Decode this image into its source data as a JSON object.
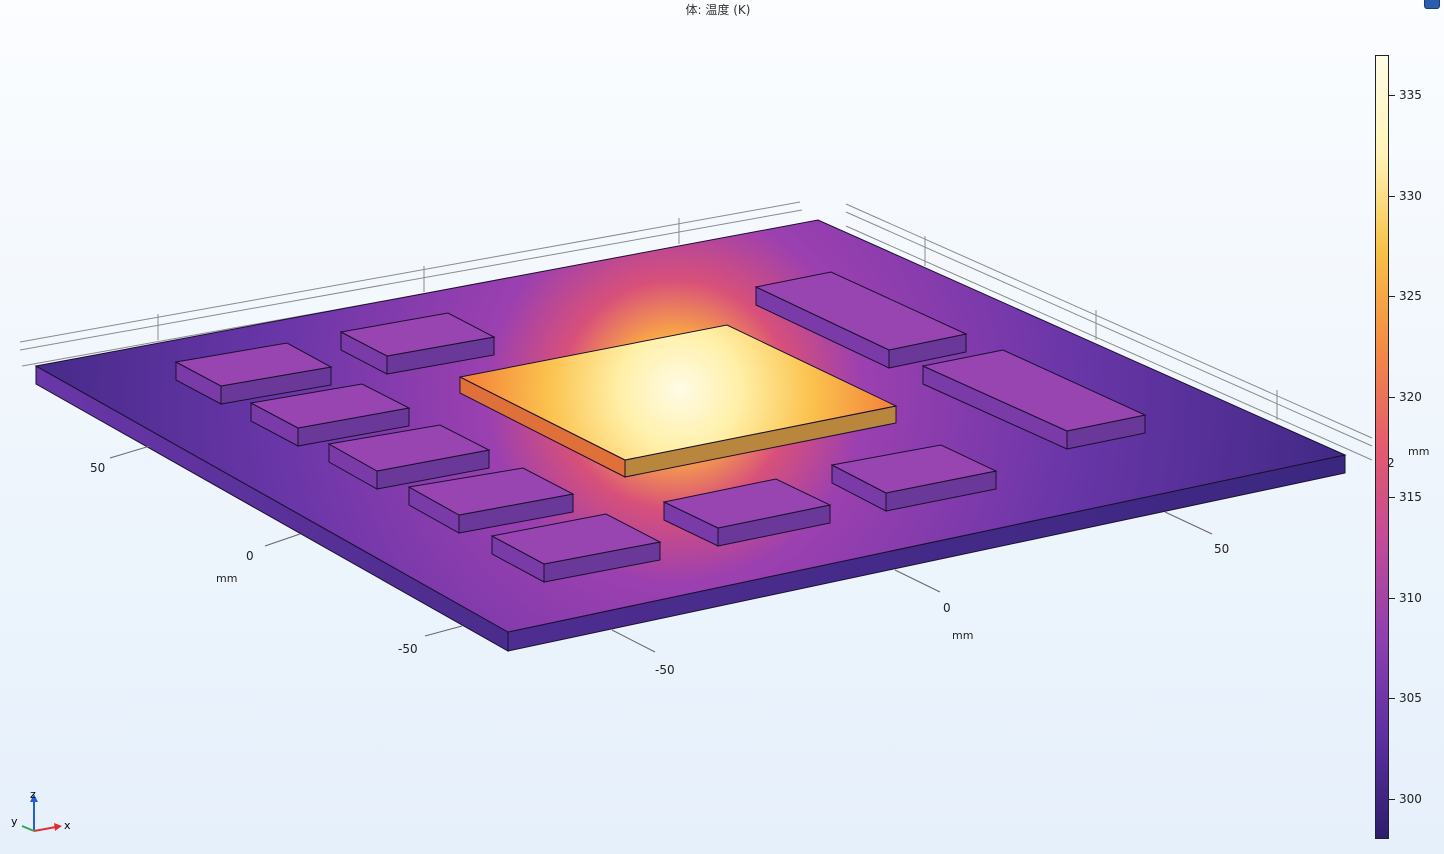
{
  "plot": {
    "title": "体: 温度 (K)"
  },
  "axes": {
    "left_ticks": [
      "50",
      "0",
      "-50"
    ],
    "left_unit": "mm",
    "right_ticks": [
      "-50",
      "0",
      "50"
    ],
    "right_unit": "mm",
    "z_tick": "2",
    "z_unit": "mm"
  },
  "colorbar": {
    "min": 298,
    "max": 337,
    "ticks": [
      "300",
      "305",
      "310",
      "315",
      "320",
      "325",
      "330",
      "335"
    ],
    "tick_values": [
      300,
      305,
      310,
      315,
      320,
      325,
      330,
      335
    ],
    "colors": [
      "#2d1e6b",
      "#5a2f9e",
      "#8b3fb0",
      "#c04a9a",
      "#e55a6e",
      "#f38a45",
      "#f9c046",
      "#fff4b8",
      "#fffbe6"
    ]
  },
  "triad": {
    "x_label": "x",
    "y_label": "y",
    "z_label": "z"
  },
  "icons": {
    "corner": "view-toolbar-icon"
  }
}
